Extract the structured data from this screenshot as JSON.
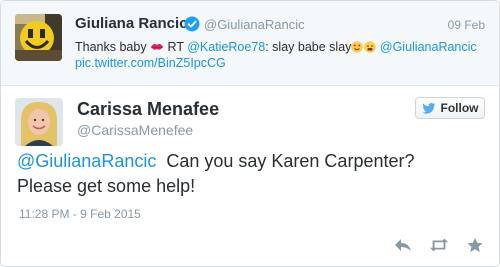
{
  "parent_tweet": {
    "author_name": "Giuliana Rancic",
    "author_handle": "@GiulianaRancic",
    "date": "09 Feb",
    "text_start": "Thanks baby ",
    "text_rt": " RT ",
    "text_mention1": "@KatieRoe78",
    "text_middle": ": slay babe slay",
    "text_mention2": "@GiulianaRancic",
    "link": "pic.twitter.com/BinZ5IpcCG"
  },
  "main_tweet": {
    "author_name": "Carissa Menafee",
    "author_handle": "@CarissaMenefee",
    "follow_label": "Follow",
    "mention": "@GiulianaRancic",
    "text_line1": "  Can you say Karen Carpenter?",
    "text_line2": "Please get some help!",
    "timestamp": "11:28 PM - 9 Feb 2015"
  },
  "colors": {
    "link": "#1b95e0",
    "meta": "#8899a6",
    "verified": "#1da1f2",
    "twitter_blue": "#55acee"
  },
  "icons": {
    "verified": "verified-badge-icon",
    "kiss": "kiss-mark-icon",
    "heart_eyes": "heart-eyes-emoji-icon",
    "tired": "tired-face-emoji-icon",
    "follow_bird": "twitter-bird-icon",
    "reply": "reply-icon",
    "retweet": "retweet-icon",
    "favorite": "star-icon"
  }
}
